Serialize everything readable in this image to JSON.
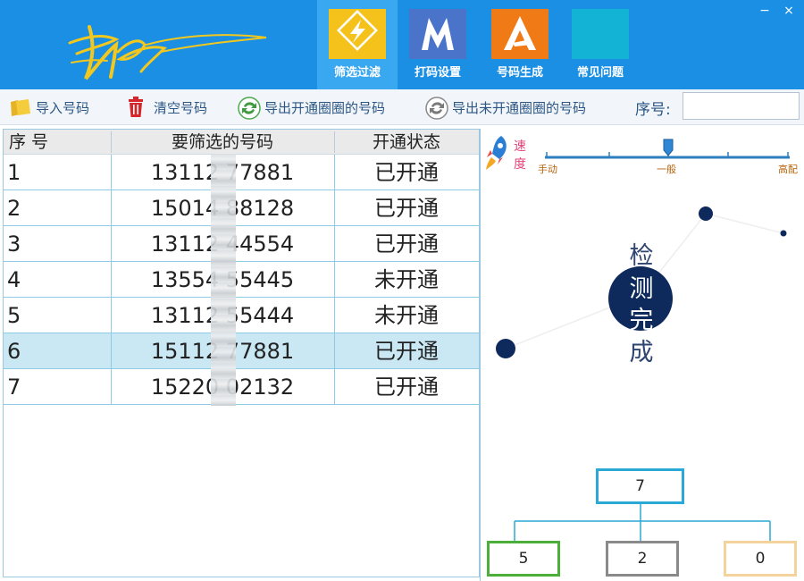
{
  "header": {
    "nav": [
      {
        "label": "筛选过滤",
        "icon": "lightning-icon",
        "color": "#f5c21b",
        "active": true
      },
      {
        "label": "打码设置",
        "icon": "m-logo-icon",
        "color": "#4a74c9",
        "active": false
      },
      {
        "label": "号码生成",
        "icon": "a-logo-icon",
        "color": "#f07a16",
        "active": false
      },
      {
        "label": "常见问题",
        "icon": "blank-tile-icon",
        "color": "#13b3d6",
        "active": false
      }
    ],
    "window_controls": {
      "minimize": "−",
      "close": "×"
    }
  },
  "toolbar": {
    "import_label": "导入号码",
    "clear_label": "清空号码",
    "export_open_label": "导出开通圈圈的号码",
    "export_unopen_label": "导出未开通圈圈的号码",
    "seq_label": "序号:",
    "seq_value": ""
  },
  "table": {
    "columns": [
      "序 号",
      "要筛选的号码",
      "开通状态"
    ],
    "rows": [
      {
        "seq": "1",
        "number": "13112 77881",
        "status": "已开通"
      },
      {
        "seq": "2",
        "number": "15014 88128",
        "status": "已开通"
      },
      {
        "seq": "3",
        "number": "13112 44554",
        "status": "已开通"
      },
      {
        "seq": "4",
        "number": "13554 55445",
        "status": "未开通"
      },
      {
        "seq": "5",
        "number": "13112 55444",
        "status": "未开通"
      },
      {
        "seq": "6",
        "number": "15112 77881",
        "status": "已开通"
      },
      {
        "seq": "7",
        "number": "15220 02132",
        "status": "已开通"
      }
    ],
    "selected_row": 6
  },
  "speed": {
    "label_1": "速",
    "label_2": "度",
    "ticks": [
      "手动",
      "一般",
      "高配"
    ],
    "level": 0.5
  },
  "status": {
    "chars": [
      "检",
      "测",
      "完",
      "成"
    ]
  },
  "counts": {
    "total": "7",
    "opened": "5",
    "unopened": "2",
    "other": "0",
    "colors": {
      "total": "#2aa9d6",
      "opened": "#4caf3a",
      "unopened": "#8a8a8a",
      "other": "#f3d29b"
    }
  }
}
